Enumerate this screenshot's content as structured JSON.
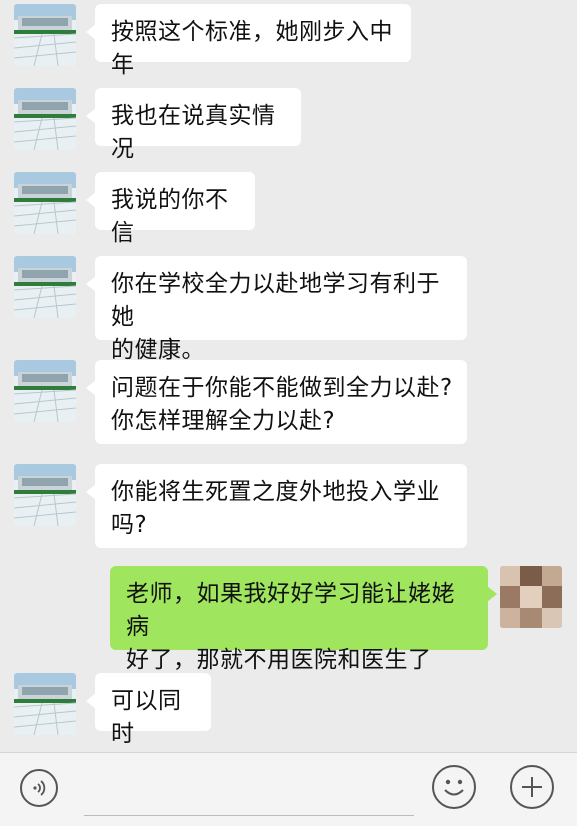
{
  "messages": [
    {
      "side": "in",
      "text": "按照这个标准，她刚步入中年"
    },
    {
      "side": "in",
      "text": "我也在说真实情况"
    },
    {
      "side": "in",
      "text": "我说的你不信"
    },
    {
      "side": "in",
      "text": "你在学校全力以赴地学习有利于她\n的健康。"
    },
    {
      "side": "in",
      "text": "问题在于你能不能做到全力以赴?\n你怎样理解全力以赴?"
    },
    {
      "side": "in",
      "text": "你能将生死置之度外地投入学业\n吗?"
    },
    {
      "side": "out",
      "text": "老师，如果我好好学习能让姥姥病\n好了，那就不用医院和医生了"
    },
    {
      "side": "in",
      "text": "可以同时"
    }
  ],
  "colors": {
    "background": "#ebebeb",
    "incoming_bubble": "#ffffff",
    "outgoing_bubble": "#9fe55e"
  },
  "icons": {
    "voice": "voice-icon",
    "emoji": "emoji-icon",
    "plus": "plus-icon"
  }
}
